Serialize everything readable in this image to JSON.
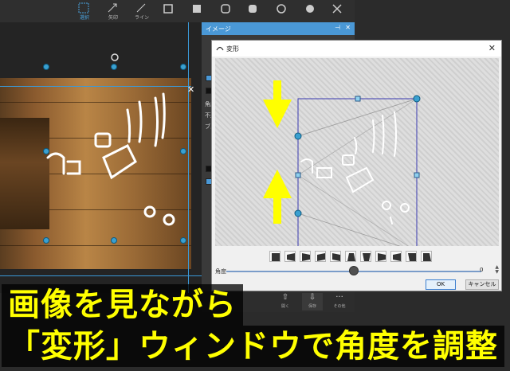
{
  "toolbar": {
    "tools": [
      {
        "label": "選択",
        "icon": "selection-icon"
      },
      {
        "label": "矢印",
        "icon": "arrow-icon"
      },
      {
        "label": "ライン",
        "icon": "line-icon"
      },
      {
        "label": "",
        "icon": "rectangle-icon"
      },
      {
        "label": "",
        "icon": "filled-rectangle-icon"
      },
      {
        "label": "",
        "icon": "rounded-rectangle-icon"
      },
      {
        "label": "",
        "icon": "filled-rounded-rectangle-icon"
      },
      {
        "label": "",
        "icon": "circle-icon"
      },
      {
        "label": "",
        "icon": "filled-circle-icon"
      },
      {
        "label": "",
        "icon": "close-icon"
      }
    ]
  },
  "property_panel": {
    "title": "イメージ",
    "labels": [
      "角度",
      "不透",
      "ブル"
    ]
  },
  "bottom_bar": {
    "buttons": [
      {
        "label": "開く"
      },
      {
        "label": "保存"
      },
      {
        "label": "その他"
      }
    ]
  },
  "dialog": {
    "title": "変形",
    "angle_label": "角度",
    "angle_value": "0",
    "angle_fraction": 0.5,
    "ok_label": "OK",
    "cancel_label": "キャンセル",
    "preset_count": 11
  },
  "caption": {
    "line1": "画像を見ながら",
    "line2": "「変形」ウィンドウで角度を調整"
  },
  "colors": {
    "accent": "#4a98d6",
    "caption_text": "#ffff00",
    "arrow": "#ffff00",
    "selection": "#3a3ab0"
  }
}
